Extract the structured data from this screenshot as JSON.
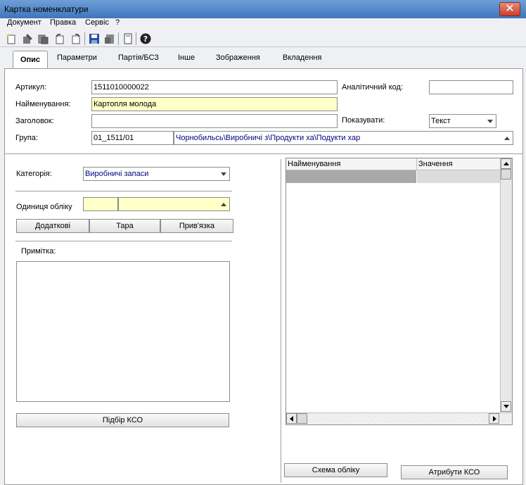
{
  "window": {
    "title": "Картка номенклатури",
    "close_glyph": "✕"
  },
  "menu": [
    "Документ",
    "Правка",
    "Сервіс",
    "?"
  ],
  "toolbar": {
    "icons": [
      "new-doc-icon",
      "edit-icon",
      "copy-icon",
      "undo-icon",
      "redo-icon",
      "save-icon",
      "delete-icon",
      "page-icon",
      "help-icon"
    ]
  },
  "tabs": [
    "Опис",
    "Параметри",
    "Партія/БСЗ",
    "Інше",
    "Зображення",
    "Вкладення"
  ],
  "form": {
    "article_label": "Артикул:",
    "article_value": "1511010000022",
    "name_label": "Найменування:",
    "name_value": "Картопля молода",
    "header_label": "Заголовок:",
    "header_value": "",
    "group_label": "Група:",
    "group_code": "01_1511/01",
    "group_path": "Чорнобильсь\\Виробничі з\\Продукти ха\\Подукти хар",
    "analytic_label": "Аналітичний код:",
    "analytic_value": "",
    "show_label": "Показувати:",
    "show_value": "Текст"
  },
  "left": {
    "category_label": "Категорія:",
    "category_value": "Виробничі запаси",
    "unit_label": "Одиниця обліку",
    "unit_code": "",
    "unit_name": "",
    "btn_extra": "Додаткові",
    "btn_tara": "Тара",
    "btn_binding": "Прив'язка",
    "note_label": "Примітка:",
    "note_value": "",
    "btn_kso": "Підбір КСО"
  },
  "grid": {
    "col_name": "Найменування",
    "col_value": "Значення"
  },
  "bottom": {
    "btn_scheme": "Схема обліку",
    "btn_attrs": "Атрибути КСО"
  },
  "colors": {
    "title_bar": "#4f86c9",
    "close": "#c8402c",
    "required_field": "#ffffc8",
    "link_text": "#000080"
  }
}
